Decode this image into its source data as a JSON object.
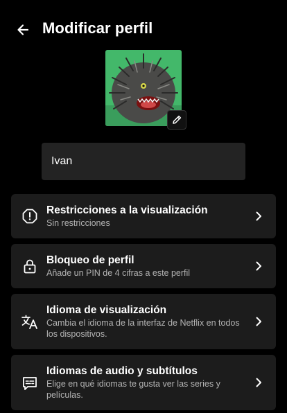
{
  "header": {
    "title": "Modificar perfil",
    "back_icon": "arrow-left-icon"
  },
  "profile": {
    "avatar_icon": "profile-avatar-image",
    "edit_icon": "pencil-icon",
    "name_value": "Ivan"
  },
  "settings": [
    {
      "icon": "warning-octagon-icon",
      "title": "Restricciones a la visualización",
      "subtitle": "Sin restricciones"
    },
    {
      "icon": "lock-icon",
      "title": "Bloqueo de perfil",
      "subtitle": "Añade un PIN de 4 cifras a este perfil"
    },
    {
      "icon": "translate-icon",
      "title": "Idioma de visualización",
      "subtitle": "Cambia el idioma de la interfaz de Netflix en todos los dispositivos."
    },
    {
      "icon": "subtitles-icon",
      "title": "Idiomas de audio y subtítulos",
      "subtitle": "Elige en qué idiomas te gusta ver las series y películas."
    }
  ],
  "colors": {
    "background": "#000000",
    "card": "#1c1c1c",
    "field": "#232323",
    "subtext": "#b3b3b3"
  }
}
